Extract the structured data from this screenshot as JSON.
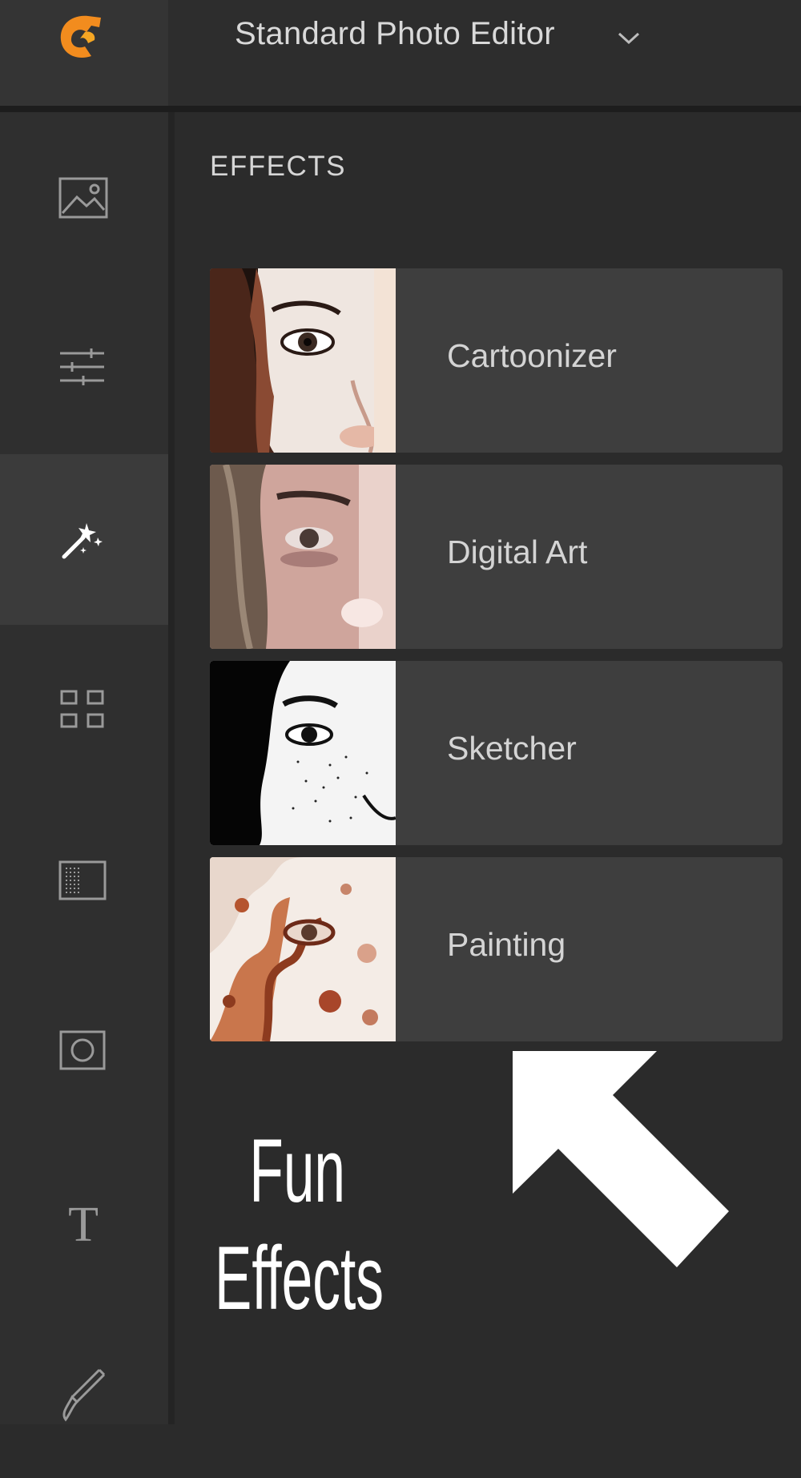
{
  "header": {
    "logo_icon": "app-logo-icon",
    "editor_mode": "Standard Photo Editor",
    "chevron_icon": "chevron-down-icon"
  },
  "sidebar": {
    "tools": [
      {
        "icon": "image-icon",
        "active": false
      },
      {
        "icon": "sliders-icon",
        "active": false
      },
      {
        "icon": "magic-wand-icon",
        "active": true
      },
      {
        "icon": "grid-icon",
        "active": false
      },
      {
        "icon": "texture-icon",
        "active": false
      },
      {
        "icon": "frame-icon",
        "active": false
      },
      {
        "icon": "text-icon",
        "active": false
      },
      {
        "icon": "brush-icon",
        "active": false
      }
    ]
  },
  "panel": {
    "title": "EFFECTS",
    "effects": [
      {
        "label": "Cartoonizer"
      },
      {
        "label": "Digital Art"
      },
      {
        "label": "Sketcher"
      },
      {
        "label": "Painting"
      }
    ]
  },
  "callout": {
    "line1": "Fun",
    "line2": "Effects",
    "arrow_icon": "arrow-up-left-icon"
  },
  "colors": {
    "background": "#2b2b2b",
    "sidebar": "#2f2f2f",
    "active_tool": "#3b3b3b",
    "card": "#3e3e3e",
    "logo_orange": "#f28c1e"
  }
}
